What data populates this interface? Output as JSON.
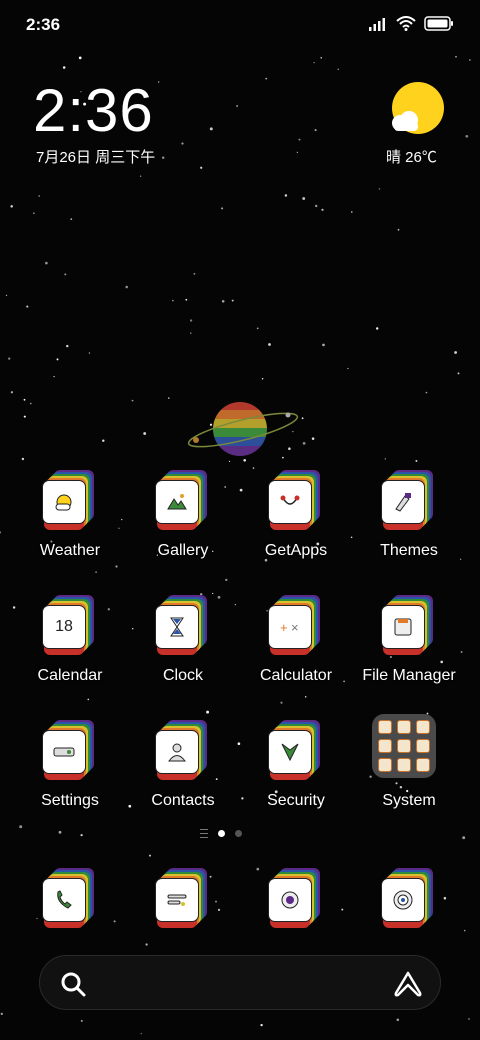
{
  "status_bar": {
    "time": "2:36"
  },
  "home": {
    "clock": "2:36",
    "date": "7月26日 周三下午",
    "weather": "晴 26℃"
  },
  "apps": [
    {
      "label": "Weather",
      "icon": "weather-icon"
    },
    {
      "label": "Gallery",
      "icon": "gallery-icon"
    },
    {
      "label": "GetApps",
      "icon": "getapps-icon"
    },
    {
      "label": "Themes",
      "icon": "themes-icon"
    },
    {
      "label": "Calendar",
      "icon": "calendar-icon",
      "glyph": "18"
    },
    {
      "label": "Clock",
      "icon": "clock-icon"
    },
    {
      "label": "Calculator",
      "icon": "calculator-icon"
    },
    {
      "label": "File Manager",
      "icon": "file-manager-icon"
    },
    {
      "label": "Settings",
      "icon": "settings-icon"
    },
    {
      "label": "Contacts",
      "icon": "contacts-icon"
    },
    {
      "label": "Security",
      "icon": "security-icon"
    },
    {
      "label": "System",
      "icon": "folder-icon"
    }
  ],
  "dock": [
    {
      "icon": "phone-icon"
    },
    {
      "icon": "messages-icon"
    },
    {
      "icon": "browser-icon"
    },
    {
      "icon": "camera-icon"
    }
  ],
  "colors": {
    "background": "#050505",
    "sun": "#ffd21e",
    "folder": "#4a4a4a"
  }
}
